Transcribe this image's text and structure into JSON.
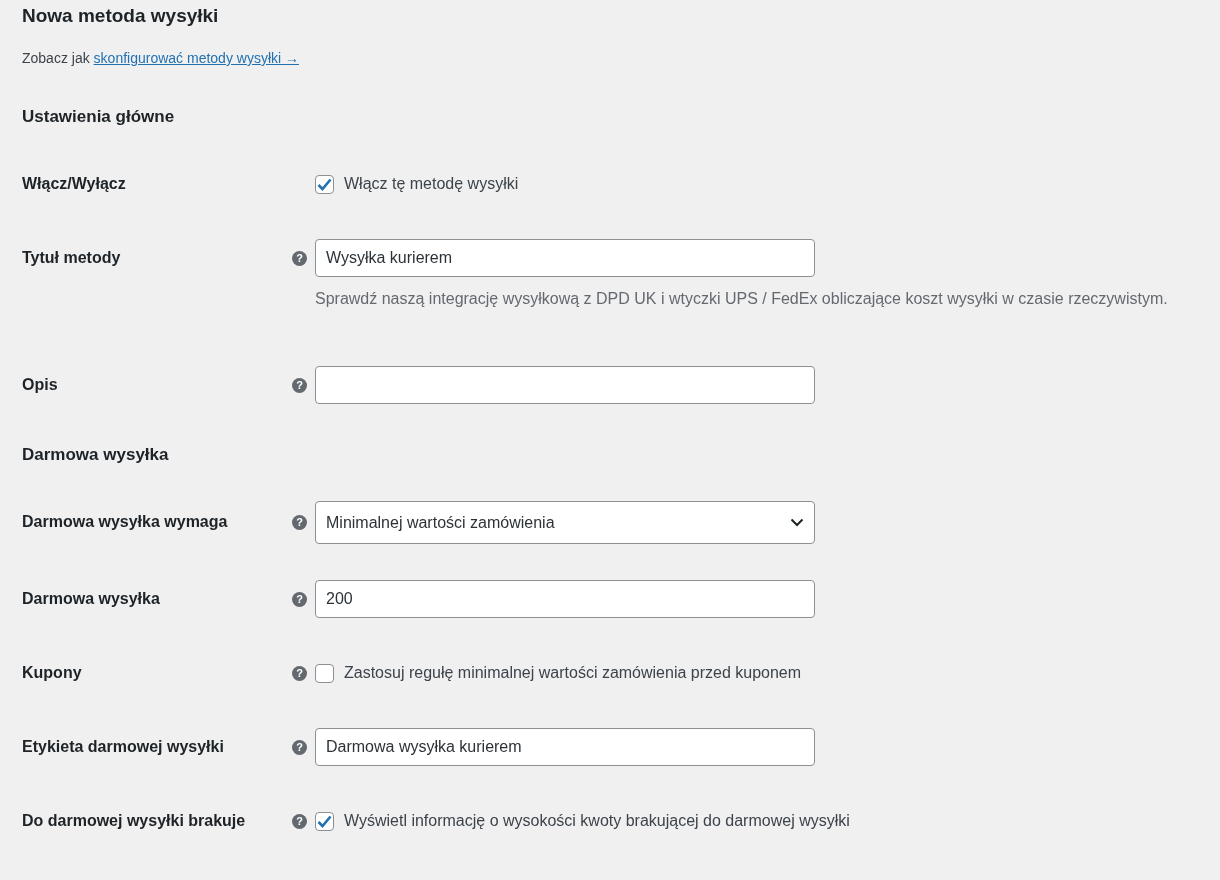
{
  "title": "Nowa metoda wysyłki",
  "intro": {
    "text": "Zobacz jak",
    "link": "skonfigurować metody wysyłki →"
  },
  "sections": [
    {
      "heading": "Ustawienia główne",
      "fields": [
        {
          "kind": "checkbox",
          "label": "Włącz/Wyłącz",
          "checked": true,
          "text": "Włącz tę metodę wysyłki"
        },
        {
          "kind": "text",
          "label": "Tytuł metody",
          "help": "?",
          "value": "Wysyłka kurierem",
          "description": "Sprawdź naszą integrację wysyłkową z DPD UK i wtyczki UPS / FedEx obliczające koszt wysyłki w czasie rzeczywistym."
        },
        {
          "kind": "text",
          "label": "Opis",
          "help": "?"
        }
      ]
    },
    {
      "heading": "Darmowa wysyłka",
      "fields": [
        {
          "kind": "select",
          "label": "Darmowa wysyłka wymaga",
          "help": "?",
          "value": "Minimalnej wartości zamówienia"
        },
        {
          "kind": "text",
          "label": "Darmowa wysyłka",
          "help": "?",
          "value": "200"
        },
        {
          "kind": "checkbox",
          "label": "Kupony",
          "help": "?",
          "checked": false,
          "text": "Zastosuj regułę minimalnej wartości zamówienia przed kuponem"
        },
        {
          "kind": "text",
          "label": "Etykieta darmowej wysyłki",
          "help": "?",
          "value": "Darmowa wysyłka kurierem"
        },
        {
          "kind": "checkbox",
          "label": "Do darmowej wysyłki brakuje",
          "help": "?",
          "checked": true,
          "text": "Wyświetl informację o wysokości kwoty brakującej do darmowej wysyłki"
        }
      ]
    }
  ]
}
